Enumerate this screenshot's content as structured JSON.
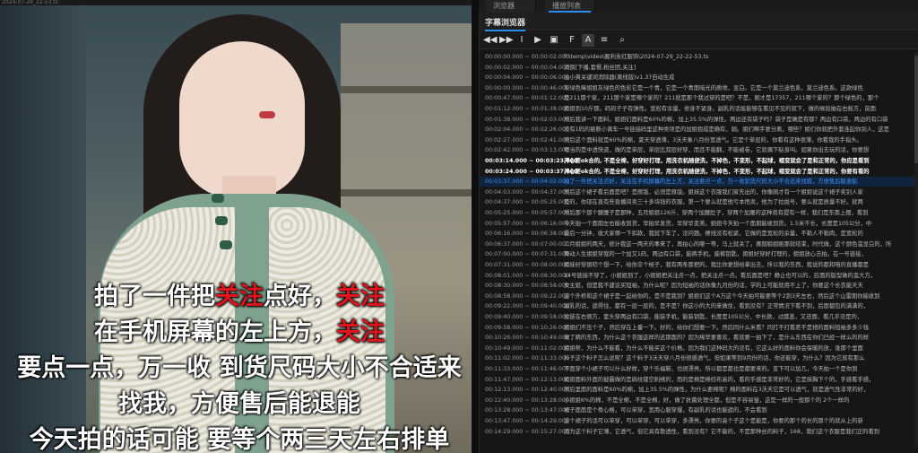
{
  "video": {
    "topbar_text": "2024-07-29_22-53.ts",
    "watermark": "靓利永红"
  },
  "subtitles_overlay": {
    "line1_a": "拍了一件把",
    "line1_b": "关注",
    "line1_c": "点好，",
    "line1_d": "关注",
    "line2_a": "在手机屏幕的左上方，",
    "line2_b": "关注",
    "line3": "要点一点，万一收 到货尺码大小不合适来",
    "line4": "找我，方便售后能退能",
    "line5": "今天拍的话可能 要等个两三天左右排单",
    "highlight_color": "#e0141c"
  },
  "top_tabs": [
    {
      "label": "浏览器"
    },
    {
      "label": "播放列表"
    }
  ],
  "panel": {
    "title": "字幕浏览器",
    "tools": [
      {
        "icon": "rewind-icon",
        "glyph": "◀◀"
      },
      {
        "icon": "forward-icon",
        "glyph": "▶▶"
      },
      {
        "icon": "text-cursor-icon",
        "glyph": "I"
      },
      {
        "icon": "video-icon",
        "glyph": "▶"
      },
      {
        "icon": "image-icon",
        "glyph": "▣"
      },
      {
        "icon": "font-icon",
        "glyph": "F"
      },
      {
        "icon": "font-size-icon",
        "glyph": "A"
      },
      {
        "icon": "menu-icon",
        "glyph": "≡"
      },
      {
        "icon": "search-icon",
        "glyph": "⌕"
      }
    ],
    "rows": [
      {
        "time": "00:00:00.000 ~ 00:00:02.000",
        "text": "F:\\temp\\video\\靓利永红服饰\\2024-07-29_22-22-53.ts"
      },
      {
        "time": "00:00:02.000 ~ 00:00:04.000",
        "text": "消倒[下播,套餐,粉丝团,关注]"
      },
      {
        "time": "00:00:04.000 ~ 00:00:06.000",
        "text": "由小爽关键词消除器(离线版)v1.37自动生成"
      },
      {
        "time": "00:00:00.000 ~ 00:00:46.000",
        "text": "灰绿色嘛姐姐灰绿色的色彩它是一个青，它是一个青面暗光的质地，显白。它是一个莫兰迪色系，莫兰迪色系。这款绿色"
      },
      {
        "time": "00:00:47.000 ~ 00:01:12.000",
        "text": "是211那个家，211那个家是哪个家的？211就是那个我过穿的是吧？不是，刚才是17357，211哪个家的？那个绿色的，那个"
      },
      {
        "time": "00:01:12.000 ~ 00:01:38.000",
        "text": "姐姐到10斤那。码码子子有弹性。宽松有余量，修身不紧身。副乳的话挺能够在看见不见的就下，做的候段抽在右舱方，前面"
      },
      {
        "time": "00:01:38.000 ~ 00:02:03.000",
        "text": "然后我讲一下面料，姐姐们面料是60%的棉，加上35.5%的弹性。两边还有袋子吗？袋子是确是有那？两边有口袋，两边的有口袋"
      },
      {
        "time": "00:02:04.000 ~ 00:02:26.000",
        "text": "没有1码的剔断小黄车一号链接码里这种类项是的加姐姐成是确有，刚。姐们啊手要分离，哪些？姐们你就把外套连起你别人，这是"
      },
      {
        "time": "00:02:27.000 ~ 00:02:41.000",
        "text": "然后这个面料就是60%的棉，夏天穿透薄，3沃天象八月份宽透气。它是个单层的，你看有这种很薄，你看我的手指头。"
      },
      {
        "time": "00:02:42.000 ~ 00:03:13.000",
        "text": "嗯当的是中透快道，做的是单层，单层比双层好穿，而且不能翻，不能被卷，它就偶下贴身叫。如果你出去玩的话，你要想"
      },
      {
        "time": "00:03:14.000 ~ 00:03:23.000",
        "text": "开心要ok合的, 不是全棉，好穿好打理，用洗衣机随便洗，不掉色，不变形，不起球，褶变就会了是和正常的，你应是看到"
      },
      {
        "time": "00:03:24.000 ~ 00:03:37.000",
        "text": "开心要ok合的, 不是全棉，好穿好打理，用洗衣机随便洗，不掉色，不变形，不起球，褶变就会了是和正常的，你要有看的"
      },
      {
        "time": "00:03:37.000 ~ 00:04:02.000",
        "text": "拍了一件把关注点好，关注在手机屏幕的左上方，关注要点一点，万一收到货尺码大小不合适来找我，方便售后能退能",
        "selected": true
      },
      {
        "time": "00:04:03.000 ~ 00:04:37.000",
        "text": "然后这个裙子看后面是吧？是原版，必须是原版。姐妹这个衣服我们家先出的，你像刚才有一个姐姐说这个裙子卖别人家"
      },
      {
        "time": "00:04:37.000 ~ 00:05:25.000",
        "text": "是的，你现在直有些直播间卖三十多块钱的衣服，第一个要么就是他亏本甩卖，他为了拉拢号，要么就是质量不好。就两"
      },
      {
        "time": "00:05:25.000 ~ 00:05:57.000",
        "text": "然后那个那个腰腰子是那种，五月姐姐126斤，穿两个加腰肚子，穿两个加腰的这种就有提有一样，我们是东南上摆，看到"
      },
      {
        "time": "00:05:57.000 ~ 00:06:16.000",
        "text": "今天拍一个面期左右能收到货，早拍早发货，早穿早变美。姐姐今天拍一个面期能收到货。1.5米不长，长度是105公分，中"
      },
      {
        "time": "00:06:16.000 ~ 00:06:38.000",
        "text": "最后一分钟，收大家哪一下扣款，我就下车了，没问题。擦线没有松紧，它做的是宽松的余量，不勒人不勒肉，是宽松的"
      },
      {
        "time": "00:06:37.000 ~ 00:07:00.000",
        "text": "二月姐姐的两天，统计我这一两天的事来了，再拍心的哪一等，马上就关了。赛期姐姐刚那就结束，时代做，这个颜色蛮显白的，所"
      },
      {
        "time": "00:07:00.000 ~ 00:07:31.000",
        "text": "舞动人生姐姐穿我的一个加又1码，两边有口袋，能裤手机，能裤钥匙，姐姐好穿好打理的，姐姐放心去拍。在一号链接，"
      },
      {
        "time": "00:07:31.000 ~ 00:08:00.000",
        "text": "姐妹好穿姐叨个想一下，给你辛个候子，我有两条那把的，我比你更想给拿出去，所以我的东西，我说的都和咱的直播都是"
      },
      {
        "time": "00:08:01.000 ~ 00:08:30.000",
        "text": "14号链接不穿了，小姐姐到了，小姐姐把关注点一点，把关注点一点。看后面是吧？静止也可以的，后面的版型做的蛮大方，"
      },
      {
        "time": "00:08:30.000 ~ 00:08:58.000",
        "text": "女主姐，但是我不建议买短袖，为什么呢？因为短袖的话你像九月份的话，学的上可能就用不上了，你要这个长衣能天天"
      },
      {
        "time": "00:08:58.000 ~ 00:09:22.000",
        "text": "这个外桥和这个裙子是一起给你的，是不是我到？姐姐们这个A万这个今天拍可能要等个2到3天左右，然后这个山雷期你能收到"
      },
      {
        "time": "00:09:22.000 ~ 00:09:40.000",
        "text": "副乳的话，遮得住，都有一层一层的，是不是？你这小的大的来做住，看到没有？正常情况下看不到，后面都包的满满的，"
      },
      {
        "time": "00:09:40.000 ~ 00:09:58.000",
        "text": "拉链在右侧方，套头穿两边有口袋，能装手机，能装钥匙，长度是105公分，中长款，过膝盖，又还面，看几乎没是的，"
      },
      {
        "time": "00:09:58.000 ~ 00:10:26.000",
        "text": "姐姐们不压个子，然后穿在上番一下。好的，给你们想要一下。然后同什么米看？同打不打看差不是稍的面料短袖多多少钱"
      },
      {
        "time": "00:10:26.000 ~ 00:10:49.000",
        "text": "做了精的东西，为什么这个衣服这样的还那面的？因为稀罕要喜欢，看就要一拍下了，是什么东西在你们已经一样么的的样"
      },
      {
        "time": "00:10:49.000 ~ 00:11:02.000",
        "text": "姐姐帮，为什么不能看，为什么不能买这个价格，因为我们这种码大的没有，它这么好的面料你会保暖的放，谁那个里面"
      },
      {
        "time": "00:11:02.000 ~ 00:11:33.000",
        "text": "抖子这个料子怎么说呢？这个料子3沃天穿八月份很感透气，但如果等到9月份的话，你还能穿，为什么？因为它就有那么"
      },
      {
        "time": "00:11:33.000 ~ 00:11:46.000",
        "text": "下面穿个小裙子可以什么好样，穿个乐福鞋，也很漂亮，所以都是都也是都要来的。变下可以加几，今天拍一个是你到"
      },
      {
        "time": "00:11:47.000 ~ 00:12:13.000",
        "text": "姐姐面料外面的披霸做的是肩纹镂空刺绣的，而的是棉是棉纺布高的，看的手感是非常好的，它是抹胸下个的，手感看手感，"
      },
      {
        "time": "00:12:13.000 ~ 00:12:40.000",
        "text": "然后里面的面料是60%的棉，加上35.5%的弹性，为什么要棉呢？棉的面料在3沃天它是可以透气，就是透气性非常的好，"
      },
      {
        "time": "00:12:40.000 ~ 00:13:28.000",
        "text": "小姐姐6%的棉，不是全棉，不是全棉，好，做了抗菌处理全都，但是不容易皱，这是一样的一般那个的 2个一样的"
      },
      {
        "time": "00:13:28.000 ~ 00:13:47.000",
        "text": "裙子面面是个骨心格，可以单穿，宽用心服穿爆，有副乳的话也能遮的，不会看到"
      },
      {
        "time": "00:13:47.000 ~ 00:14:29.000",
        "text": "这个裙子的话可以单穿，可以单穿，可以单穿，多漂亮，你要的高个子这个是能是，你要的那个的长的那个的就从上的新"
      },
      {
        "time": "00:14:29.000 ~ 00:15:27.000",
        "text": "因为这个料子它薄，它透气，但它具有散透性，看到没有？它不能的，不是那种丝的料子，168，我们这个衣服是我们正的看到"
      }
    ]
  }
}
